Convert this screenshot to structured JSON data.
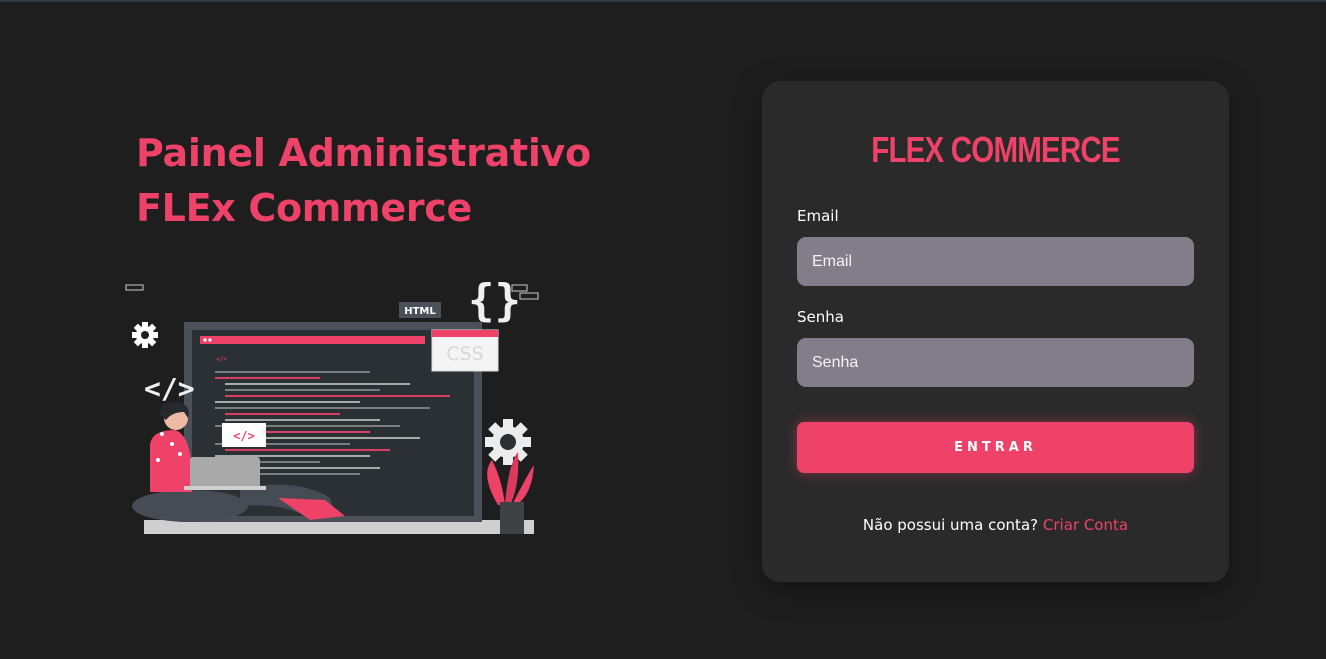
{
  "hero": {
    "title_line1": "Painel Administrativo",
    "title_line2": "FLEx Commerce",
    "illustration": {
      "html_tag": "HTML",
      "css_tag": "CSS",
      "code_tag": "</>",
      "braces": "{}"
    }
  },
  "login": {
    "brand": "FLEX COMMERCE",
    "email_label": "Email",
    "email_placeholder": "Email",
    "password_label": "Senha",
    "password_placeholder": "Senha",
    "submit_label": "ENTRAR",
    "signup_prompt": "Não possui uma conta?",
    "signup_link": "Criar Conta"
  },
  "colors": {
    "background": "#1e1e1f",
    "card": "#2a2a2b",
    "accent": "#ef4268",
    "input": "#817e8a"
  }
}
